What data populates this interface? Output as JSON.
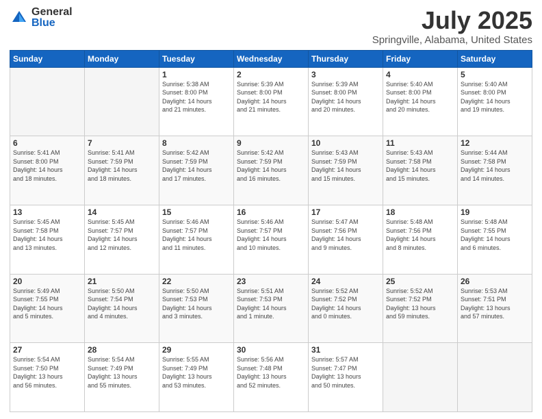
{
  "logo": {
    "general": "General",
    "blue": "Blue"
  },
  "title": "July 2025",
  "subtitle": "Springville, Alabama, United States",
  "days_header": [
    "Sunday",
    "Monday",
    "Tuesday",
    "Wednesday",
    "Thursday",
    "Friday",
    "Saturday"
  ],
  "weeks": [
    [
      {
        "day": "",
        "info": ""
      },
      {
        "day": "",
        "info": ""
      },
      {
        "day": "1",
        "info": "Sunrise: 5:38 AM\nSunset: 8:00 PM\nDaylight: 14 hours\nand 21 minutes."
      },
      {
        "day": "2",
        "info": "Sunrise: 5:39 AM\nSunset: 8:00 PM\nDaylight: 14 hours\nand 21 minutes."
      },
      {
        "day": "3",
        "info": "Sunrise: 5:39 AM\nSunset: 8:00 PM\nDaylight: 14 hours\nand 20 minutes."
      },
      {
        "day": "4",
        "info": "Sunrise: 5:40 AM\nSunset: 8:00 PM\nDaylight: 14 hours\nand 20 minutes."
      },
      {
        "day": "5",
        "info": "Sunrise: 5:40 AM\nSunset: 8:00 PM\nDaylight: 14 hours\nand 19 minutes."
      }
    ],
    [
      {
        "day": "6",
        "info": "Sunrise: 5:41 AM\nSunset: 8:00 PM\nDaylight: 14 hours\nand 18 minutes."
      },
      {
        "day": "7",
        "info": "Sunrise: 5:41 AM\nSunset: 7:59 PM\nDaylight: 14 hours\nand 18 minutes."
      },
      {
        "day": "8",
        "info": "Sunrise: 5:42 AM\nSunset: 7:59 PM\nDaylight: 14 hours\nand 17 minutes."
      },
      {
        "day": "9",
        "info": "Sunrise: 5:42 AM\nSunset: 7:59 PM\nDaylight: 14 hours\nand 16 minutes."
      },
      {
        "day": "10",
        "info": "Sunrise: 5:43 AM\nSunset: 7:59 PM\nDaylight: 14 hours\nand 15 minutes."
      },
      {
        "day": "11",
        "info": "Sunrise: 5:43 AM\nSunset: 7:58 PM\nDaylight: 14 hours\nand 15 minutes."
      },
      {
        "day": "12",
        "info": "Sunrise: 5:44 AM\nSunset: 7:58 PM\nDaylight: 14 hours\nand 14 minutes."
      }
    ],
    [
      {
        "day": "13",
        "info": "Sunrise: 5:45 AM\nSunset: 7:58 PM\nDaylight: 14 hours\nand 13 minutes."
      },
      {
        "day": "14",
        "info": "Sunrise: 5:45 AM\nSunset: 7:57 PM\nDaylight: 14 hours\nand 12 minutes."
      },
      {
        "day": "15",
        "info": "Sunrise: 5:46 AM\nSunset: 7:57 PM\nDaylight: 14 hours\nand 11 minutes."
      },
      {
        "day": "16",
        "info": "Sunrise: 5:46 AM\nSunset: 7:57 PM\nDaylight: 14 hours\nand 10 minutes."
      },
      {
        "day": "17",
        "info": "Sunrise: 5:47 AM\nSunset: 7:56 PM\nDaylight: 14 hours\nand 9 minutes."
      },
      {
        "day": "18",
        "info": "Sunrise: 5:48 AM\nSunset: 7:56 PM\nDaylight: 14 hours\nand 8 minutes."
      },
      {
        "day": "19",
        "info": "Sunrise: 5:48 AM\nSunset: 7:55 PM\nDaylight: 14 hours\nand 6 minutes."
      }
    ],
    [
      {
        "day": "20",
        "info": "Sunrise: 5:49 AM\nSunset: 7:55 PM\nDaylight: 14 hours\nand 5 minutes."
      },
      {
        "day": "21",
        "info": "Sunrise: 5:50 AM\nSunset: 7:54 PM\nDaylight: 14 hours\nand 4 minutes."
      },
      {
        "day": "22",
        "info": "Sunrise: 5:50 AM\nSunset: 7:53 PM\nDaylight: 14 hours\nand 3 minutes."
      },
      {
        "day": "23",
        "info": "Sunrise: 5:51 AM\nSunset: 7:53 PM\nDaylight: 14 hours\nand 1 minute."
      },
      {
        "day": "24",
        "info": "Sunrise: 5:52 AM\nSunset: 7:52 PM\nDaylight: 14 hours\nand 0 minutes."
      },
      {
        "day": "25",
        "info": "Sunrise: 5:52 AM\nSunset: 7:52 PM\nDaylight: 13 hours\nand 59 minutes."
      },
      {
        "day": "26",
        "info": "Sunrise: 5:53 AM\nSunset: 7:51 PM\nDaylight: 13 hours\nand 57 minutes."
      }
    ],
    [
      {
        "day": "27",
        "info": "Sunrise: 5:54 AM\nSunset: 7:50 PM\nDaylight: 13 hours\nand 56 minutes."
      },
      {
        "day": "28",
        "info": "Sunrise: 5:54 AM\nSunset: 7:49 PM\nDaylight: 13 hours\nand 55 minutes."
      },
      {
        "day": "29",
        "info": "Sunrise: 5:55 AM\nSunset: 7:49 PM\nDaylight: 13 hours\nand 53 minutes."
      },
      {
        "day": "30",
        "info": "Sunrise: 5:56 AM\nSunset: 7:48 PM\nDaylight: 13 hours\nand 52 minutes."
      },
      {
        "day": "31",
        "info": "Sunrise: 5:57 AM\nSunset: 7:47 PM\nDaylight: 13 hours\nand 50 minutes."
      },
      {
        "day": "",
        "info": ""
      },
      {
        "day": "",
        "info": ""
      }
    ]
  ]
}
